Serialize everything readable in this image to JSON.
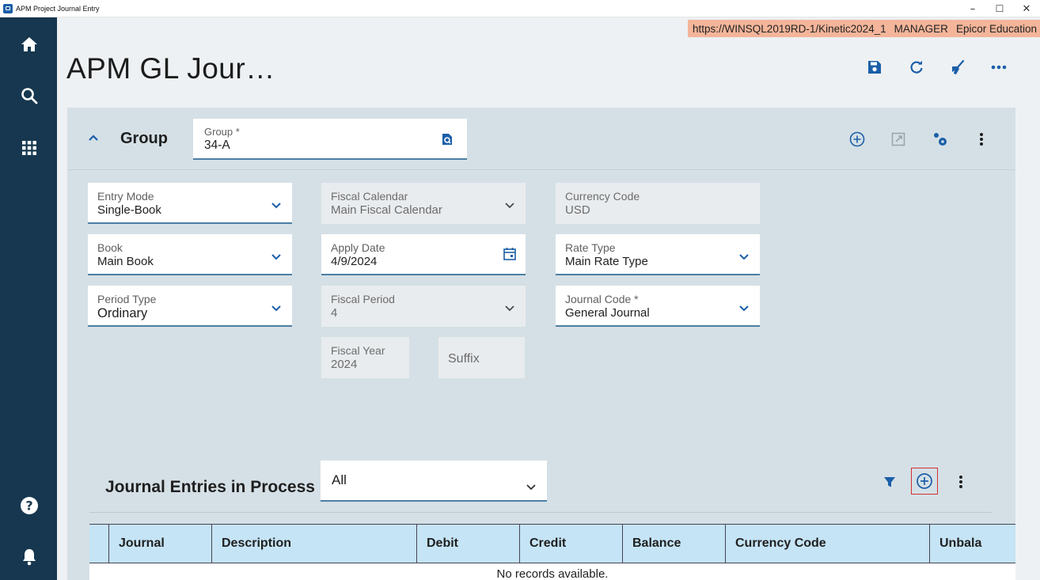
{
  "window": {
    "title": "APM Project Journal Entry",
    "controls": {
      "minimize": "–",
      "maximize": "☐",
      "close": "✕"
    }
  },
  "sidebar": {
    "items": [
      {
        "icon": "home-icon"
      },
      {
        "icon": "search-icon"
      },
      {
        "icon": "apps-grid-icon"
      },
      {
        "icon": "help-icon"
      },
      {
        "icon": "notification-bell-icon"
      }
    ]
  },
  "env": {
    "url": "https://WINSQL2019RD-1/Kinetic2024_1",
    "user": "MANAGER",
    "company": "Epicor Education"
  },
  "page": {
    "title": "APM GL Jour…"
  },
  "toolbar": [
    "save-icon",
    "refresh-icon",
    "clear-broom-icon",
    "more-horizontal-icon"
  ],
  "group": {
    "header": "Group",
    "field": {
      "label": "Group *",
      "value": "34-A"
    }
  },
  "fields": {
    "entry_mode": {
      "label": "Entry Mode",
      "value": "Single-Book"
    },
    "fiscal_calendar": {
      "label": "Fiscal Calendar",
      "value": "Main Fiscal Calendar"
    },
    "currency_code": {
      "label": "Currency Code",
      "value": "USD"
    },
    "book": {
      "label": "Book",
      "value": "Main Book"
    },
    "apply_date": {
      "label": "Apply Date",
      "value": "4/9/2024"
    },
    "rate_type": {
      "label": "Rate Type",
      "value": "Main Rate Type"
    },
    "period_type": {
      "label": "Period Type",
      "value": "Ordinary"
    },
    "fiscal_period": {
      "label": "Fiscal Period",
      "value": "4"
    },
    "journal_code": {
      "label": "Journal Code *",
      "value": "General Journal"
    },
    "fiscal_year": {
      "label": "Fiscal Year",
      "value": "2024"
    },
    "suffix": {
      "label": "Suffix"
    }
  },
  "journal": {
    "title": "Journal Entries in Process",
    "filter_value": "All",
    "columns": [
      "",
      "Journal",
      "Description",
      "Debit",
      "Credit",
      "Balance",
      "Currency Code",
      "Unbala"
    ],
    "empty_message": "No records available."
  },
  "colors": {
    "sidebar": "#16374f",
    "accent": "#1b5fa8",
    "env_badge": "#f4b59a",
    "grid_header": "#c5e4f6",
    "highlight_border": "#d32f2f"
  }
}
